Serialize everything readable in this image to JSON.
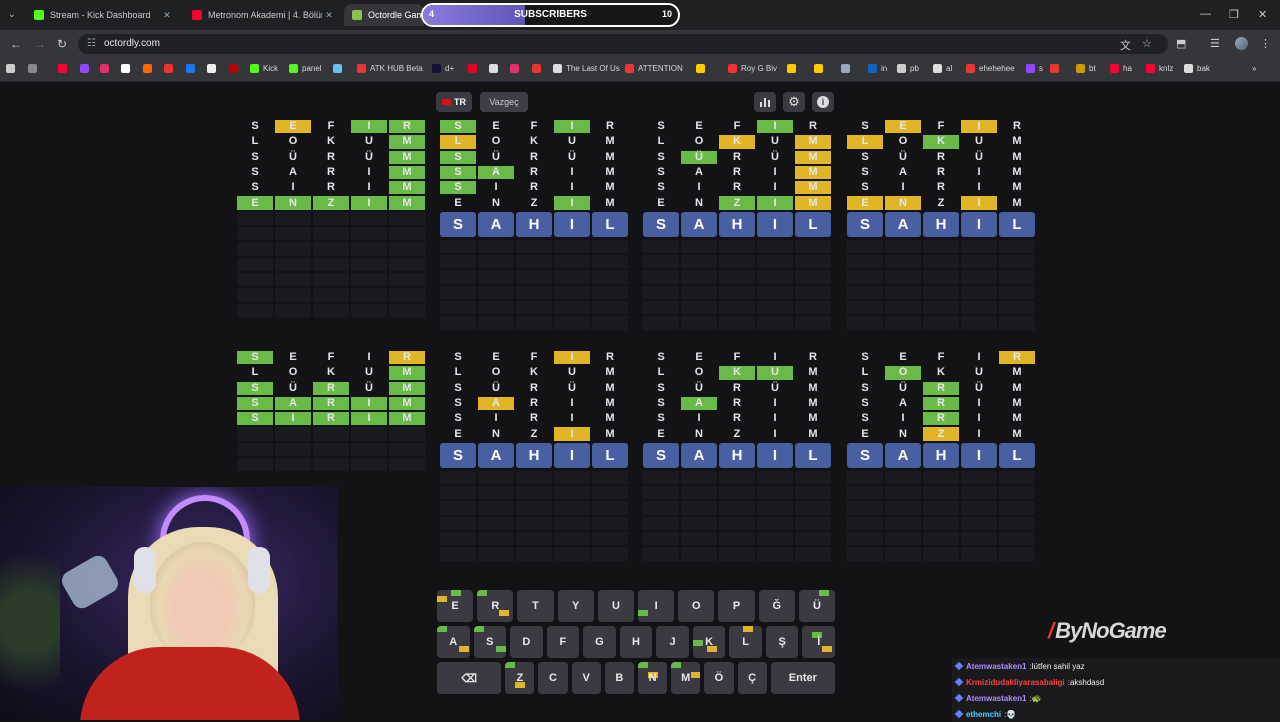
{
  "browser": {
    "tabs": [
      {
        "title": "Stream - Kick Dashboard",
        "color": "#53fc18"
      },
      {
        "title": "Metronom Akademi | 4. Bölüm",
        "color": "#ff0033"
      },
      {
        "title": "Octordle Game",
        "color": "#8bc34a"
      }
    ],
    "url": "octordly.com",
    "bookmarks": [
      "Kick",
      "panel",
      "ATK HUB Beta",
      "d+",
      "The Last Of Us",
      "ATTENTION",
      "Roy G Biv",
      "in",
      "pb",
      "al",
      "ehehehee",
      "s",
      "bt",
      "ha",
      "knlz",
      "bak"
    ]
  },
  "subscribers": {
    "label": "SUBSCRIBERS",
    "current": "4",
    "goal": "10",
    "progress": 0.4
  },
  "toolbar": {
    "lang": "TR",
    "give_up": "Vazgeç"
  },
  "icons": {
    "stats": "bar-chart-icon",
    "settings": "gear-icon",
    "info": "info-icon"
  },
  "colors": {
    "green": "#6aba48",
    "yellow": "#e0b627",
    "solved": "#4a5fa1"
  },
  "boards": [
    {
      "guesses": [
        "SEFIR/.y.gg",
        "LOKUM/....g",
        "SÜRÜM/....g",
        "SARIM/....g",
        "SIRIM/....g",
        "ENZIM/ggggg"
      ],
      "solution": ""
    },
    {
      "guesses": [
        "SEFIR/g..g.",
        "LOKUM/y....",
        "SÜRÜM/g....",
        "SARIM/gg...",
        "SIRIM/g....",
        "ENZIM/...g."
      ],
      "solution": "SAHIL"
    },
    {
      "guesses": [
        "SEFIR/...g.",
        "LOKUM/..y.y",
        "SÜRÜM/.g..y",
        "SARIM/....y",
        "SIRIM/....y",
        "ENZIM/..ggy"
      ],
      "solution": "SAHIL"
    },
    {
      "guesses": [
        "SEFIR/.y.y.",
        "LOKUM/y.g..",
        "SÜRÜM/.....",
        "SARIM/.....",
        "SIRIM/.....",
        "ENZIM/yy.y."
      ],
      "solution": "SAHIL"
    },
    {
      "guesses": [
        "SEFIR/g...y",
        "LOKUM/....g",
        "SÜRÜM/g.g.g",
        "SARIM/ggggg",
        "SIRIM/ggggg"
      ],
      "solution": ""
    },
    {
      "guesses": [
        "SEFIR/...y.",
        "LOKUM/.....",
        "SÜRÜM/.....",
        "SARIM/.y...",
        "SIRIM/.....",
        "ENZIM/...y."
      ],
      "solution": "SAHIL"
    },
    {
      "guesses": [
        "SEFIR/.....",
        "LOKUM/..gg.",
        "SÜRÜM/.....",
        "SARIM/.g...",
        "SIRIM/.....",
        "ENZIM/....."
      ],
      "solution": "SAHIL"
    },
    {
      "guesses": [
        "SEFIR/....y",
        "LOKUM/.g...",
        "SÜRÜM/..g..",
        "SARIM/..g..",
        "SIRIM/..g..",
        "ENZIM/..y.."
      ],
      "solution": "SAHIL"
    }
  ],
  "keyboard": {
    "row1": [
      "E",
      "R",
      "T",
      "Y",
      "U",
      "I",
      "O",
      "P",
      "Ğ",
      "Ü"
    ],
    "row2": [
      "A",
      "S",
      "D",
      "F",
      "G",
      "H",
      "J",
      "K",
      "L",
      "Ş",
      "İ"
    ],
    "row3": [
      "⌫",
      "Z",
      "C",
      "V",
      "B",
      "N",
      "M",
      "Ö",
      "Ç",
      "Enter"
    ]
  },
  "chat": [
    {
      "user": "Atemwastaken1",
      "sep": " : ",
      "text": "lütfen sahil yaz",
      "color": "#b18cff"
    },
    {
      "user": "Krmizidudakliyarasabaligi",
      "sep": " : ",
      "text": "akshdasd",
      "color": "#ff4040"
    },
    {
      "user": "Atemwastaken1",
      "sep": " : ",
      "text": "🐢",
      "color": "#b18cff"
    },
    {
      "user": "ethemchi",
      "sep": " : ",
      "text": "💀",
      "color": "#3fd6ff"
    }
  ],
  "watermark": "ByNoGame"
}
